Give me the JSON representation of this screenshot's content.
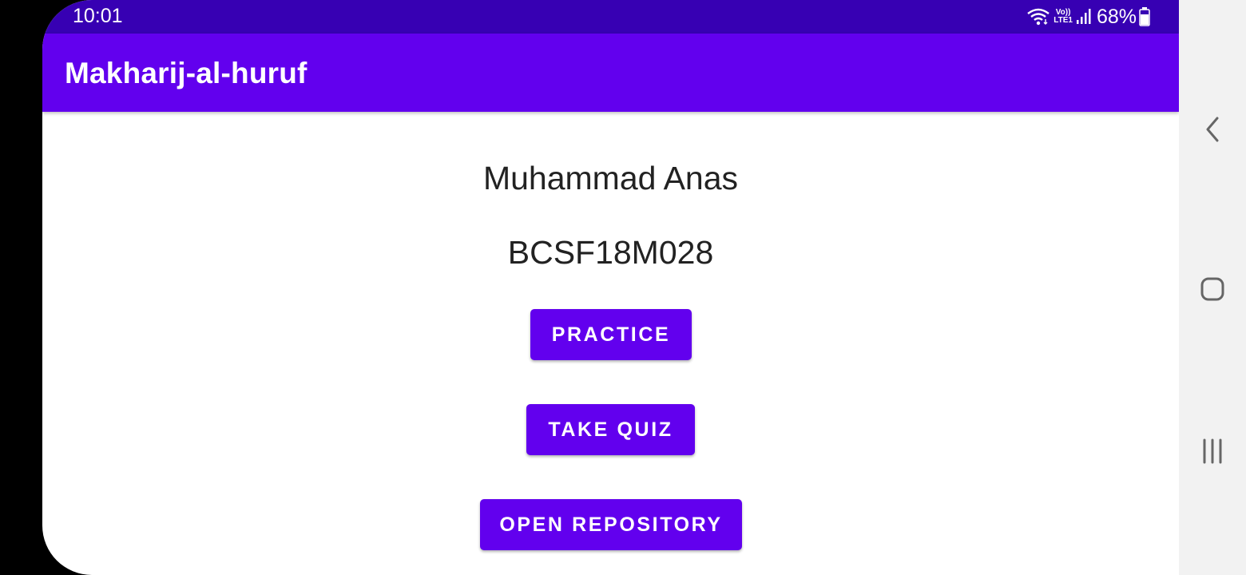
{
  "status_bar": {
    "time": "10:01",
    "battery": "68%",
    "icons": [
      "wifi-icon",
      "volte-lte-icon",
      "signal-icon",
      "battery-icon"
    ],
    "volte_label": "Vo))",
    "lte_label": "LTE1"
  },
  "app_bar": {
    "title": "Makharij-al-huruf"
  },
  "main": {
    "name": "Muhammad Anas",
    "student_id": "BCSF18M028",
    "buttons": {
      "practice": "PRACTICE",
      "take_quiz": "TAKE QUIZ",
      "open_repository": "OPEN REPOSITORY"
    }
  },
  "nav_bar": {
    "icons": [
      "back-icon",
      "home-icon",
      "recents-icon"
    ]
  },
  "colors": {
    "status_bar": "#3700b3",
    "app_bar": "#6200ee",
    "button": "#6200ee",
    "nav_bar": "#f2f2f2"
  }
}
